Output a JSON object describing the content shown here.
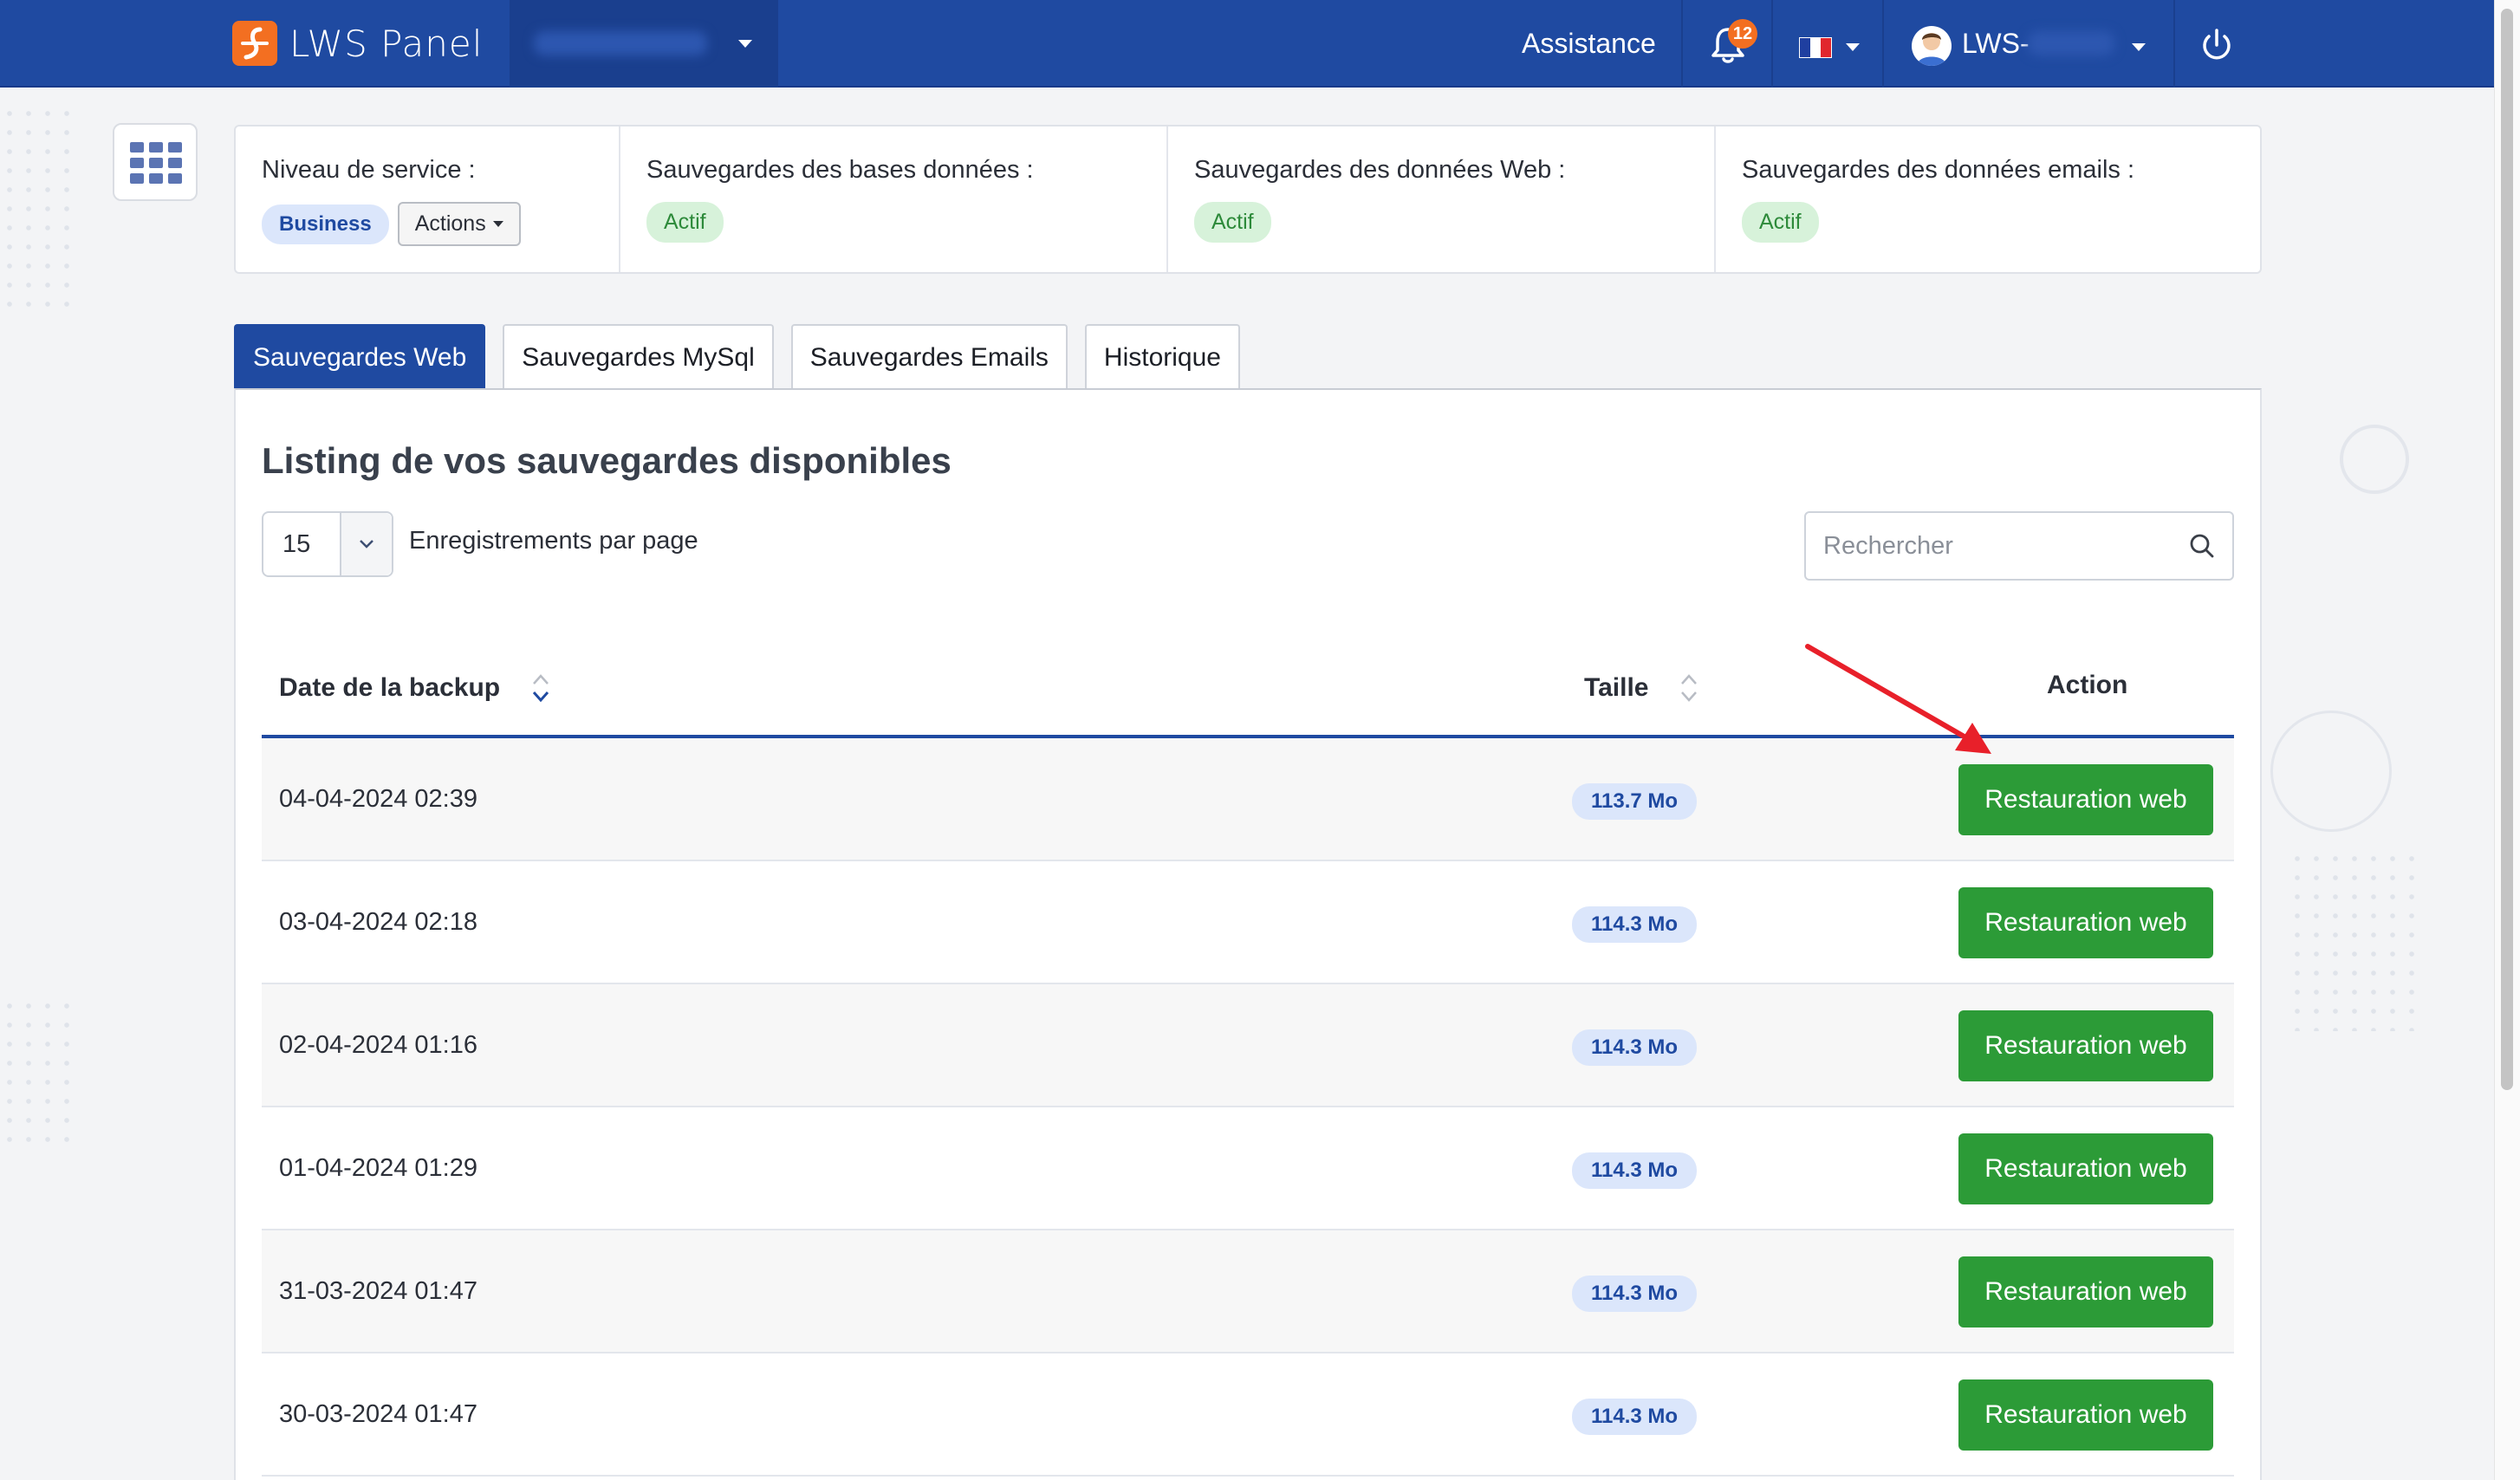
{
  "header": {
    "brand_name": "LWS Panel",
    "nav_assistance": "Assistance",
    "notification_count": "12",
    "user_name": "LWS-",
    "icons": [
      "logo-icon",
      "bell-icon",
      "france-flag-icon",
      "avatar-icon",
      "power-icon"
    ]
  },
  "status_panel": {
    "service_level_label": "Niveau de service :",
    "service_level_value": "Business",
    "actions_label": "Actions",
    "db_backups_label": "Sauvegardes des bases données :",
    "db_backups_status": "Actif",
    "web_backups_label": "Sauvegardes des données Web :",
    "web_backups_status": "Actif",
    "email_backups_label": "Sauvegardes des données emails :",
    "email_backups_status": "Actif"
  },
  "tabs": [
    {
      "label": "Sauvegardes Web",
      "active": true
    },
    {
      "label": "Sauvegardes MySql",
      "active": false
    },
    {
      "label": "Sauvegardes Emails",
      "active": false
    },
    {
      "label": "Historique",
      "active": false
    }
  ],
  "listing": {
    "title": "Listing de vos sauvegardes disponibles",
    "page_length": "15",
    "page_length_label": "Enregistrements par page",
    "search_placeholder": "Rechercher",
    "columns": {
      "date": "Date de la backup",
      "size": "Taille",
      "action": "Action"
    },
    "rows": [
      {
        "date": "04-04-2024 02:39",
        "size": "113.7 Mo",
        "action": "Restauration web"
      },
      {
        "date": "03-04-2024 02:18",
        "size": "114.3 Mo",
        "action": "Restauration web"
      },
      {
        "date": "02-04-2024 01:16",
        "size": "114.3 Mo",
        "action": "Restauration web"
      },
      {
        "date": "01-04-2024 01:29",
        "size": "114.3 Mo",
        "action": "Restauration web"
      },
      {
        "date": "31-03-2024 01:47",
        "size": "114.3 Mo",
        "action": "Restauration web"
      },
      {
        "date": "30-03-2024 01:47",
        "size": "114.3 Mo",
        "action": "Restauration web"
      }
    ]
  },
  "colors": {
    "primary_blue": "#1f4aa1",
    "brand_orange": "#f36f21",
    "success_green": "#2c9b37",
    "annotation_red": "#e8202a"
  }
}
